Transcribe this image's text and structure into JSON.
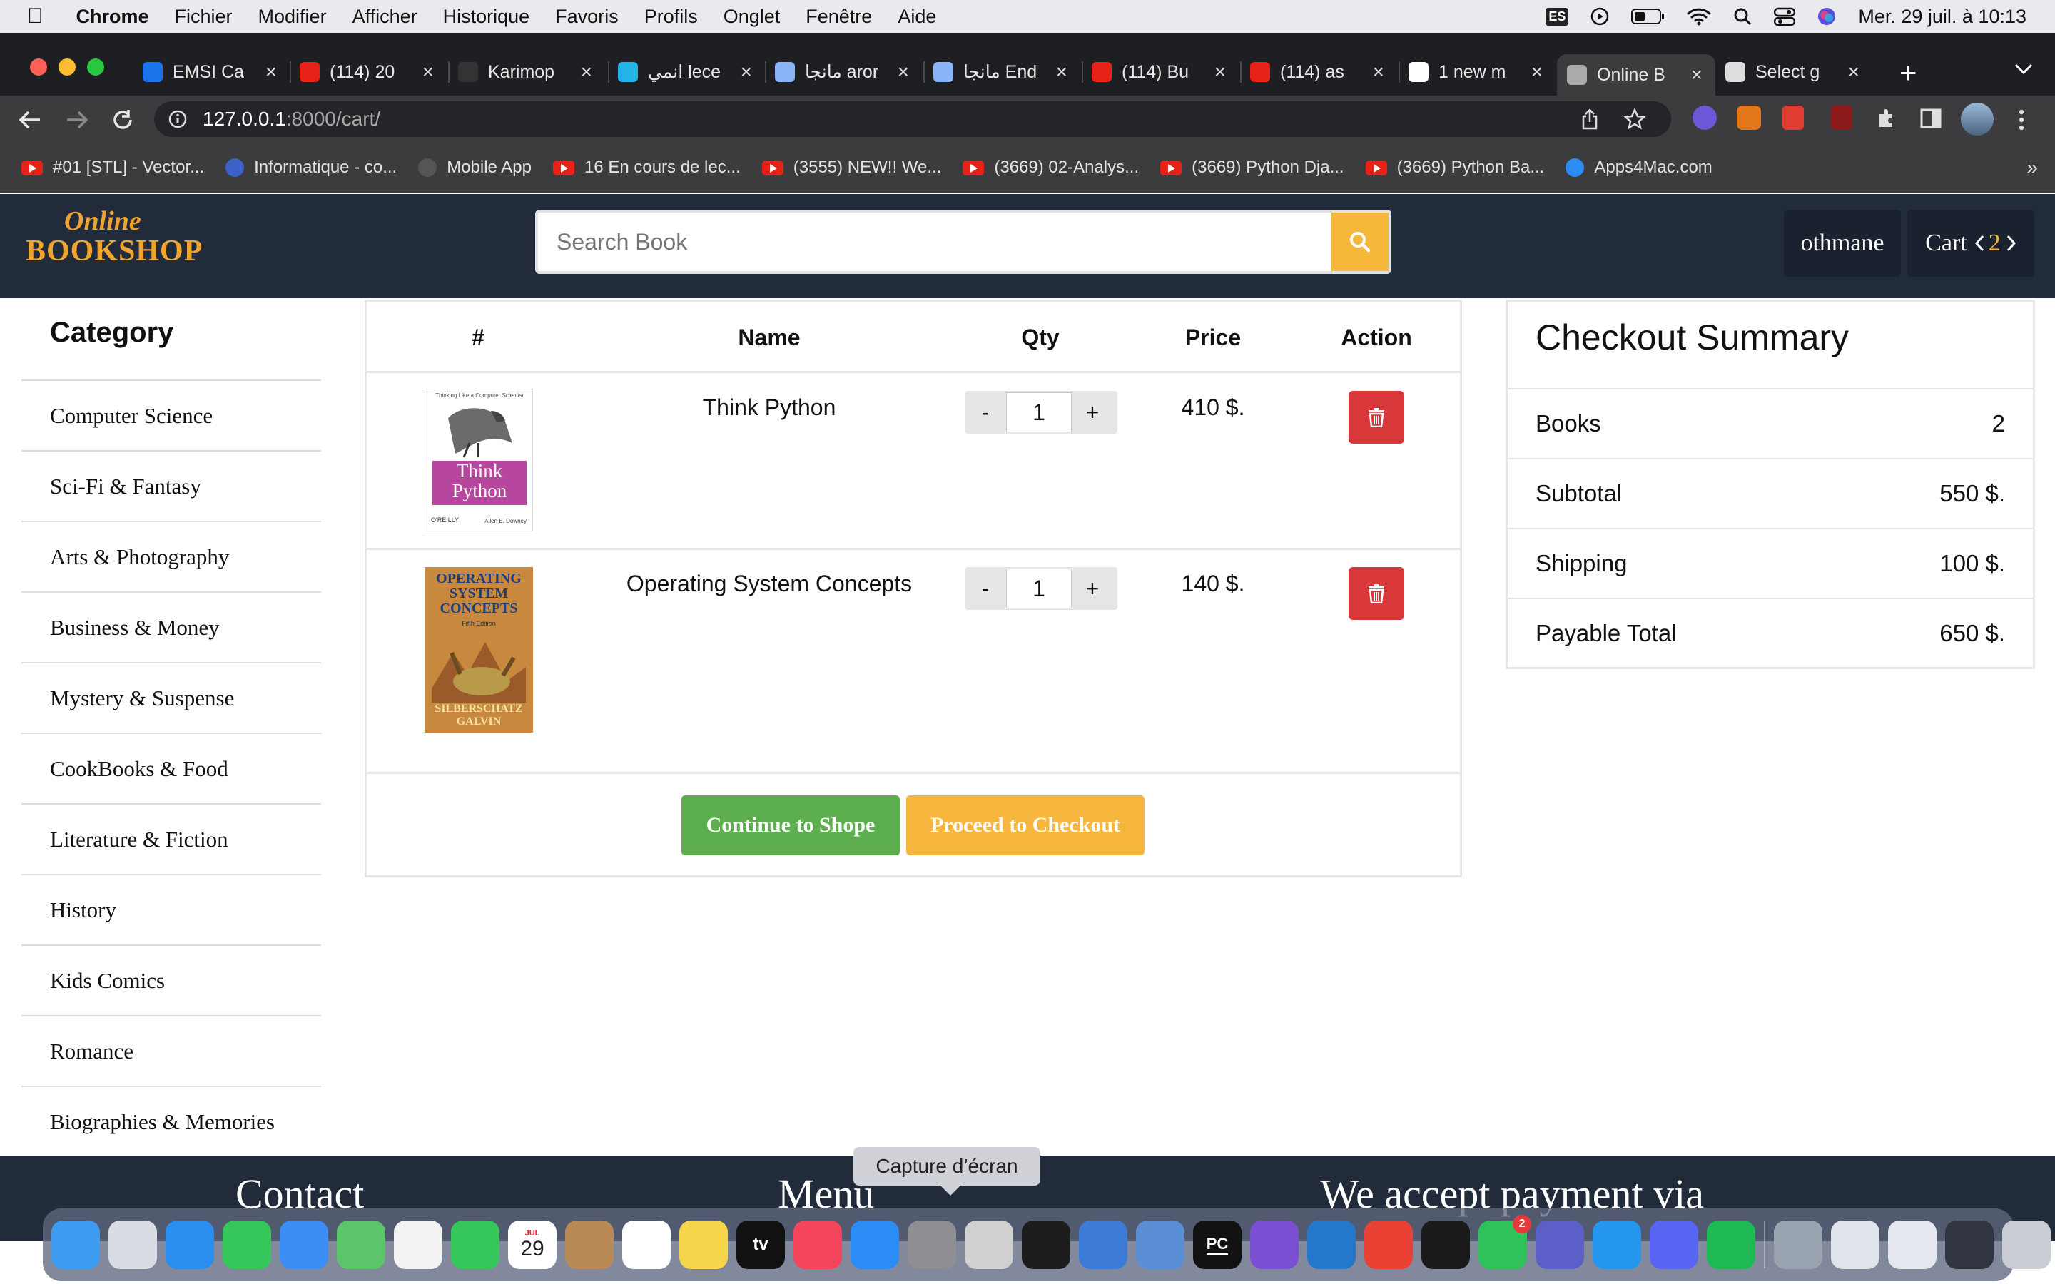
{
  "menubar": {
    "apple": "",
    "app": "Chrome",
    "items": [
      "Fichier",
      "Modifier",
      "Afficher",
      "Historique",
      "Favoris",
      "Profils",
      "Onglet",
      "Fenêtre",
      "Aide"
    ],
    "input_source": "ES",
    "datetime": "Mer. 29 juil. à  10:13"
  },
  "tabs": [
    {
      "title": "EMSI Ca",
      "icon": "c-icon",
      "color": "#1a73e8"
    },
    {
      "title": "(114) 20",
      "icon": "youtube-icon",
      "color": "#e62117"
    },
    {
      "title": "Karimop",
      "icon": "github-icon",
      "color": "#333"
    },
    {
      "title": "انمي leсe",
      "icon": "w-icon",
      "color": "#24b3e6"
    },
    {
      "title": "مانجا aror",
      "icon": "manga-icon",
      "color": "#8ab4f8"
    },
    {
      "title": "مانجا End",
      "icon": "manga-icon",
      "color": "#8ab4f8"
    },
    {
      "title": "(114) Bu",
      "icon": "youtube-icon",
      "color": "#e62117"
    },
    {
      "title": "(114) as",
      "icon": "youtube-icon",
      "color": "#e62117"
    },
    {
      "title": "1 new m",
      "icon": "gmail-icon",
      "color": "#ffffff"
    },
    {
      "title": "Online B",
      "icon": "globe-icon",
      "color": "#aaa",
      "active": true
    },
    {
      "title": "Select g",
      "icon": "globe-icon",
      "color": "#ddd"
    }
  ],
  "new_tab_label": "+",
  "address": {
    "host": "127.0.0.1",
    "path": ":8000/cart/"
  },
  "bookmarks": [
    {
      "label": "#01 [STL] - Vector...",
      "icon": "youtube-icon"
    },
    {
      "label": "Informatique - co...",
      "icon": "shield-icon"
    },
    {
      "label": "Mobile App",
      "icon": "globe-icon"
    },
    {
      "label": "16 En cours de lec...",
      "icon": "youtube-icon"
    },
    {
      "label": "(3555) NEW!! We...",
      "icon": "youtube-icon"
    },
    {
      "label": "(3669) 02-Analys...",
      "icon": "youtube-icon"
    },
    {
      "label": "(3669) Python Dja...",
      "icon": "youtube-icon"
    },
    {
      "label": "(3669) Python Ba...",
      "icon": "youtube-icon"
    },
    {
      "label": "Apps4Mac.com",
      "icon": "appstore-icon"
    }
  ],
  "bookmarks_more": "»",
  "site": {
    "logo_top": "Online",
    "logo_bottom": "BOOKSHOP",
    "search_placeholder": "Search Book",
    "user": "othmane",
    "cart_label": "Cart",
    "cart_count": "2"
  },
  "sidebar": {
    "title": "Category",
    "items": [
      "Computer Science",
      "Sci-Fi & Fantasy",
      "Arts & Photography",
      "Business & Money",
      "Mystery & Suspense",
      "CookBooks & Food",
      "Literature & Fiction",
      "History",
      "Kids Comics",
      "Romance",
      "Biographies & Memories"
    ]
  },
  "cart": {
    "headers": [
      "#",
      "Name",
      "Qty",
      "Price",
      "Action"
    ],
    "rows": [
      {
        "name": "Think Python",
        "qty": "1",
        "price": "410 $.",
        "cover_title": "Think Python",
        "cover_top": "Thinking Like a Computer Scientist",
        "cover_pub": "O'REILLY",
        "cover_author": "Allen B. Downey"
      },
      {
        "name": "Operating System Concepts",
        "qty": "1",
        "price": "140 $.",
        "cover_title": "OPERATING SYSTEM CONCEPTS",
        "cover_sub": "Fifth Edition",
        "cover_author": "SILBERSCHATZ GALVIN"
      }
    ],
    "minus": "-",
    "plus": "+",
    "continue_label": "Continue to Shope",
    "checkout_label": "Proceed to Checkout"
  },
  "summary": {
    "title": "Checkout Summary",
    "rows": [
      {
        "label": "Books",
        "value": "2"
      },
      {
        "label": "Subtotal",
        "value": "550 $."
      },
      {
        "label": "Shipping",
        "value": "100 $."
      },
      {
        "label": "Payable Total",
        "value": "650 $."
      }
    ]
  },
  "footer": {
    "contact": "Contact",
    "menu": "Menu",
    "payment": "We accept payment via"
  },
  "tooltip": "Capture d’écran",
  "dock": {
    "calendar_month": "JUL",
    "calendar_day": "29",
    "appletv": "tv",
    "pycharm": "PC",
    "whatsapp_badge": "2",
    "apps": [
      {
        "name": "finder-icon",
        "color": "#3d9bf0"
      },
      {
        "name": "launchpad-icon",
        "color": "#d9dce3"
      },
      {
        "name": "safari-icon",
        "color": "#2a8df0"
      },
      {
        "name": "messages-icon",
        "color": "#35c759"
      },
      {
        "name": "mail-icon",
        "color": "#3a8ef5"
      },
      {
        "name": "maps-icon",
        "color": "#5bc56a"
      },
      {
        "name": "photos-icon",
        "color": "#f3f3f3"
      },
      {
        "name": "facetime-icon",
        "color": "#35c759"
      },
      {
        "name": "calendar-icon",
        "color": "#ffffff"
      },
      {
        "name": "contacts-icon",
        "color": "#b98a56"
      },
      {
        "name": "reminders-icon",
        "color": "#ffffff"
      },
      {
        "name": "notes-icon",
        "color": "#f7d54a"
      },
      {
        "name": "appletv-icon",
        "color": "#111111"
      },
      {
        "name": "music-icon",
        "color": "#f5455c"
      },
      {
        "name": "appstore-icon",
        "color": "#2c8cf5"
      },
      {
        "name": "system-preferences-icon",
        "color": "#8e8e93"
      },
      {
        "name": "screenshot-icon",
        "color": "#d0d0d0"
      },
      {
        "name": "activity-monitor-icon",
        "color": "#1d1d1d"
      },
      {
        "name": "xcode-icon",
        "color": "#3d7bd9"
      },
      {
        "name": "network-icon",
        "color": "#5a8fd6"
      },
      {
        "name": "pycharm-icon",
        "color": "#111111"
      },
      {
        "name": "visual-studio-icon",
        "color": "#7b4fd1"
      },
      {
        "name": "vscode-icon",
        "color": "#2478cc"
      },
      {
        "name": "chrome-icon",
        "color": "#e94235"
      },
      {
        "name": "terminal-icon",
        "color": "#1a1a1a"
      },
      {
        "name": "whatsapp-icon",
        "color": "#2fc25b"
      },
      {
        "name": "teams-icon",
        "color": "#5b5fc7"
      },
      {
        "name": "docker-icon",
        "color": "#2496ed"
      },
      {
        "name": "discord-icon",
        "color": "#5865f2"
      },
      {
        "name": "spotify-icon",
        "color": "#1db954"
      },
      {
        "name": "preview-icon",
        "color": "#9aa3b0"
      },
      {
        "name": "recent-window-icon",
        "color": "#dfe3ea"
      },
      {
        "name": "recent-window-icon",
        "color": "#e5e8ee"
      },
      {
        "name": "recent-window-icon",
        "color": "#303540"
      },
      {
        "name": "trash-icon",
        "color": "#c9cdd3"
      }
    ]
  }
}
